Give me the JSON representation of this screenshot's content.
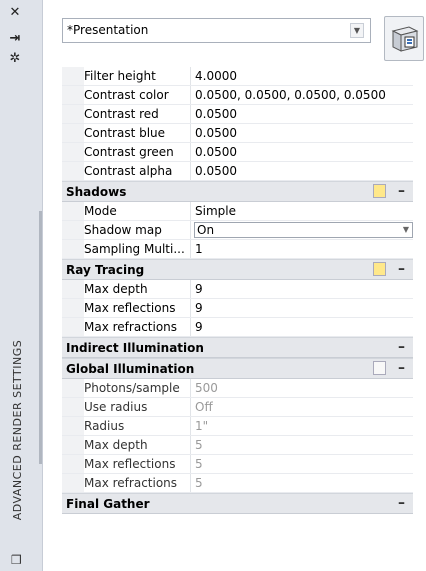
{
  "strip": {
    "title": "ADVANCED RENDER SETTINGS",
    "icons": [
      "close-icon",
      "pin-icon",
      "properties-icon"
    ]
  },
  "preset": {
    "value": "*Presentation"
  },
  "rows_top": [
    {
      "label": "Filter height",
      "value": "4.0000"
    },
    {
      "label": "Contrast color",
      "value": "0.0500, 0.0500, 0.0500, 0.0500"
    },
    {
      "label": "Contrast red",
      "value": "0.0500"
    },
    {
      "label": "Contrast blue",
      "value": "0.0500"
    },
    {
      "label": "Contrast green",
      "value": "0.0500"
    },
    {
      "label": "Contrast alpha",
      "value": "0.0500"
    }
  ],
  "shadows": {
    "title": "Shadows",
    "rows": [
      {
        "label": "Mode",
        "value": "Simple"
      },
      {
        "label": "Shadow map",
        "value": "On"
      },
      {
        "label": "Sampling  Multi...",
        "value": "1"
      }
    ]
  },
  "ray_tracing": {
    "title": "Ray Tracing",
    "rows": [
      {
        "label": "Max depth",
        "value": "9"
      },
      {
        "label": "Max reflections",
        "value": "9"
      },
      {
        "label": "Max refractions",
        "value": "9"
      }
    ]
  },
  "indirect": {
    "title": "Indirect Illumination"
  },
  "global_illumination": {
    "title": "Global Illumination",
    "rows": [
      {
        "label": "Photons/sample",
        "value": "500"
      },
      {
        "label": "Use radius",
        "value": "Off"
      },
      {
        "label": "Radius",
        "value": "1\""
      },
      {
        "label": "Max depth",
        "value": "5"
      },
      {
        "label": "Max reflections",
        "value": "5"
      },
      {
        "label": "Max refractions",
        "value": "5"
      }
    ]
  },
  "final_gather": {
    "title": "Final Gather"
  },
  "colors": {
    "bulb_on": "#ffe88a",
    "section_bg": "#e5e7eb",
    "disabled_text": "#9a9a9a"
  }
}
